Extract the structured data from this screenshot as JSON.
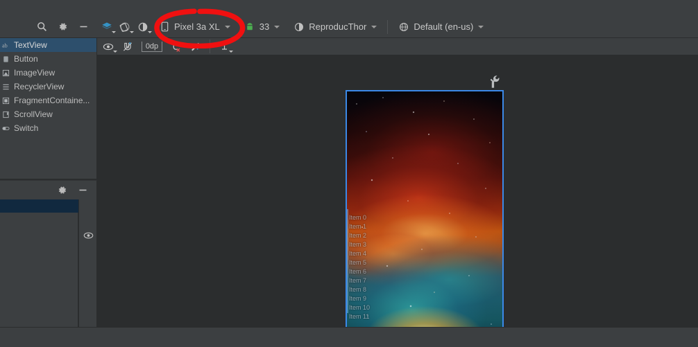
{
  "toolbar": {
    "icons": [
      {
        "name": "search-icon",
        "label": "Search"
      },
      {
        "name": "gear-icon",
        "label": "Settings"
      },
      {
        "name": "minimize-icon",
        "label": "Minimize"
      }
    ],
    "view_modes": [
      {
        "name": "design-mode-icon",
        "label": "Design"
      },
      {
        "name": "orientation-icon",
        "label": "Orientation"
      },
      {
        "name": "theme-icon",
        "label": "Theme"
      }
    ],
    "device": "Pixel 3a XL",
    "api_level": "33",
    "theme": "ReproducThor",
    "locale": "Default (en-us)"
  },
  "subbar": {
    "margin_value": "0dp",
    "tools": [
      {
        "name": "view-options-icon",
        "label": "View Options"
      },
      {
        "name": "magnet-off-icon",
        "label": "Turn Off Autoconnect"
      },
      {
        "name": "clear-constraints-icon",
        "label": "Clear All Constraints"
      },
      {
        "name": "infer-constraints-icon",
        "label": "Infer Constraints"
      },
      {
        "name": "align-icon",
        "label": "Align"
      }
    ]
  },
  "palette": {
    "items": [
      {
        "label": "TextView",
        "glyph": "ab",
        "selected": true
      },
      {
        "label": "Button",
        "glyph": "btn",
        "selected": false
      },
      {
        "label": "ImageView",
        "glyph": "img",
        "selected": false
      },
      {
        "label": "RecyclerView",
        "glyph": "list",
        "selected": false
      },
      {
        "label": "FragmentContaine...",
        "glyph": "frag",
        "selected": false
      },
      {
        "label": "ScrollView",
        "glyph": "scroll",
        "selected": false
      },
      {
        "label": "Switch",
        "glyph": "switch",
        "selected": false
      }
    ]
  },
  "attributes": {
    "icons": [
      {
        "name": "gear-icon",
        "label": "Settings"
      },
      {
        "name": "minimize-icon",
        "label": "Minimize"
      }
    ],
    "eye_icon": "visibility-icon"
  },
  "canvas": {
    "wrench_icon": "wrench-icon",
    "preview": {
      "list_items": [
        "Item 0",
        "Item 1",
        "Item 2",
        "Item 3",
        "Item 4",
        "Item 5",
        "Item 6",
        "Item 7",
        "Item 8",
        "Item 9",
        "Item 10",
        "Item 11"
      ]
    }
  },
  "annotation": {
    "name": "red-highlight-ellipse",
    "color": "#f01010",
    "target": "Pixel 3a XL"
  },
  "colors": {
    "panel_bg": "#3c3f41",
    "canvas_bg": "#2b2d2e",
    "selection_blue": "#2d4f6c",
    "preview_border": "#3b89e8",
    "accent_blue": "#3592c4"
  }
}
